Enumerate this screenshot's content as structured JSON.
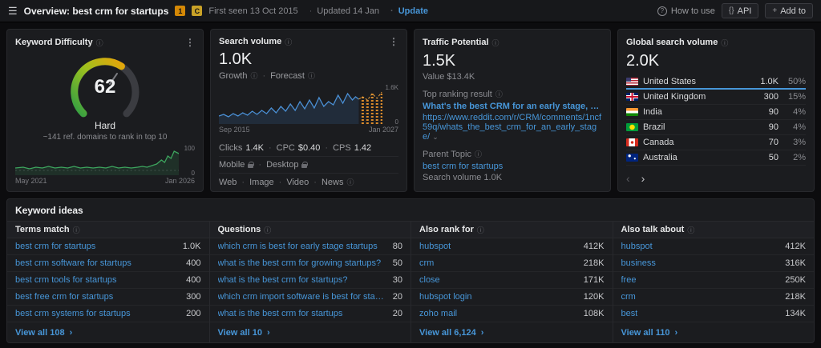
{
  "icons": {
    "hamburger": "☰",
    "menu": "⋮",
    "question": "?",
    "api": "{}",
    "plus": "+",
    "chevron_left": "‹",
    "chevron_right": "›",
    "chevron_down": "⌄",
    "view_all_arrow": "›",
    "info": "ⓘ"
  },
  "header": {
    "title_prefix": "Overview: ",
    "title_keyword": "best crm for startups",
    "badge_serp": "1",
    "badge_country": "C",
    "first_seen": "First seen 13 Oct 2015",
    "updated": "Updated 14 Jan",
    "update_link": "Update",
    "how_to_use": "How to use",
    "api_label": "API",
    "add_to_label": "Add to"
  },
  "keyword_difficulty": {
    "title": "Keyword Difficulty",
    "score": "62",
    "level": "Hard",
    "subtitle": "~141 ref. domains to rank in top 10",
    "axis_max": "100",
    "axis_min": "0",
    "date_start": "May 2021",
    "date_end": "Jan 2026"
  },
  "search_volume": {
    "title": "Search volume",
    "value": "1.0K",
    "growth_label": "Growth",
    "forecast_label": "Forecast",
    "axis_max": "1.6K",
    "axis_min": "0",
    "date_start": "Sep 2015",
    "date_end": "Jan 2027",
    "metrics": [
      {
        "label": "Clicks",
        "value": "1.4K"
      },
      {
        "label": "CPC",
        "value": "$0.40"
      },
      {
        "label": "CPS",
        "value": "1.42"
      }
    ],
    "devices": [
      "Mobile",
      "Desktop"
    ],
    "types": [
      "Web",
      "Image",
      "Video",
      "News"
    ]
  },
  "traffic_potential": {
    "title": "Traffic Potential",
    "value": "1.5K",
    "value_sub": "Value $13.4K",
    "top_label": "Top ranking result",
    "top_title": "What's the best CRM for an early stage, bootstrapped ...",
    "top_url": "https://www.reddit.com/r/CRM/comments/1ncf59q/whats_the_best_crm_for_an_early_stage/",
    "parent_label": "Parent Topic",
    "parent_keyword": "best crm for startups",
    "parent_volume": "Search volume 1.0K"
  },
  "global_volume": {
    "title": "Global search volume",
    "value": "2.0K",
    "countries": [
      {
        "name": "United States",
        "volume": "1.0K",
        "percent": "50%"
      },
      {
        "name": "United Kingdom",
        "volume": "300",
        "percent": "15%"
      },
      {
        "name": "India",
        "volume": "90",
        "percent": "4%"
      },
      {
        "name": "Brazil",
        "volume": "90",
        "percent": "4%"
      },
      {
        "name": "Canada",
        "volume": "70",
        "percent": "3%"
      },
      {
        "name": "Australia",
        "volume": "50",
        "percent": "2%"
      }
    ]
  },
  "keyword_ideas": {
    "title": "Keyword ideas",
    "columns": [
      {
        "header": "Terms match",
        "view_all": "View all 108",
        "items": [
          {
            "label": "best crm for startups",
            "value": "1.0K"
          },
          {
            "label": "best crm software for startups",
            "value": "400"
          },
          {
            "label": "best crm tools for startups",
            "value": "400"
          },
          {
            "label": "best free crm for startups",
            "value": "300"
          },
          {
            "label": "best crm systems for startups",
            "value": "200"
          }
        ]
      },
      {
        "header": "Questions",
        "view_all": "View all 10",
        "items": [
          {
            "label": "which crm is best for early stage startups",
            "value": "80"
          },
          {
            "label": "what is the best crm for growing startups?",
            "value": "50"
          },
          {
            "label": "what is the best crm for startups?",
            "value": "30"
          },
          {
            "label": "which crm import software is best for startups?",
            "value": "20"
          },
          {
            "label": "what is the best crm for startups",
            "value": "20"
          }
        ]
      },
      {
        "header": "Also rank for",
        "view_all": "View all 6,124",
        "items": [
          {
            "label": "hubspot",
            "value": "412K"
          },
          {
            "label": "crm",
            "value": "218K"
          },
          {
            "label": "close",
            "value": "171K"
          },
          {
            "label": "hubspot login",
            "value": "120K"
          },
          {
            "label": "zoho mail",
            "value": "108K"
          }
        ]
      },
      {
        "header": "Also talk about",
        "view_all": "View all 110",
        "items": [
          {
            "label": "hubspot",
            "value": "412K"
          },
          {
            "label": "business",
            "value": "316K"
          },
          {
            "label": "free",
            "value": "250K"
          },
          {
            "label": "crm",
            "value": "218K"
          },
          {
            "label": "best",
            "value": "134K"
          }
        ]
      }
    ]
  }
}
